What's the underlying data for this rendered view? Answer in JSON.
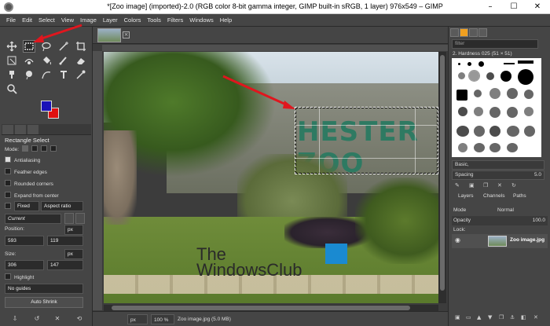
{
  "window": {
    "title": "*[Zoo image] (imported)-2.0 (RGB color 8-bit gamma integer, GIMP built-in sRGB, 1 layer) 976x549 – GIMP",
    "minimize": "–",
    "maximize": "☐",
    "close": "✕"
  },
  "menubar": [
    "File",
    "Edit",
    "Select",
    "View",
    "Image",
    "Layer",
    "Colors",
    "Tools",
    "Filters",
    "Windows",
    "Help"
  ],
  "tool_options": {
    "title": "Rectangle Select",
    "mode_label": "Mode:",
    "antialiasing": "Antialiasing",
    "feather_edges": "Feather edges",
    "rounded_corners": "Rounded corners",
    "expand_from_center": "Expand from center",
    "fixed_label": "Fixed",
    "fixed_value": "Aspect ratio",
    "current": "Current",
    "position_label": "Position:",
    "position_unit": "px",
    "position_x": "593",
    "position_y": "119",
    "size_label": "Size:",
    "size_unit": "px",
    "size_w": "306",
    "size_h": "147",
    "highlight": "Highlight",
    "guides": "No guides",
    "auto_shrink": "Auto Shrink"
  },
  "image": {
    "sign_text": "HESTER ZOO",
    "watermark_line1": "The",
    "watermark_line2": "WindowsClub"
  },
  "statusbar": {
    "unit": "px",
    "zoom": "100 %",
    "info": "Zoo image.jpg (5.0 MB)"
  },
  "brushes": {
    "filter_placeholder": "filter",
    "label": "2. Hardness 025 (51 × 51)",
    "preset": "Basic,",
    "spacing_label": "Spacing",
    "spacing_value": "5.0"
  },
  "layers": {
    "tabs": [
      "Layers",
      "Channels",
      "Paths"
    ],
    "mode_label": "Mode",
    "mode_value": "Normal",
    "opacity_label": "Opacity",
    "opacity_value": "100.0",
    "lock_label": "Lock:",
    "layer_name": "Zoo image.jpg"
  },
  "colors": {
    "foreground": "#1a12b8",
    "background": "#e01010",
    "annotation_arrow": "#e0161e"
  }
}
